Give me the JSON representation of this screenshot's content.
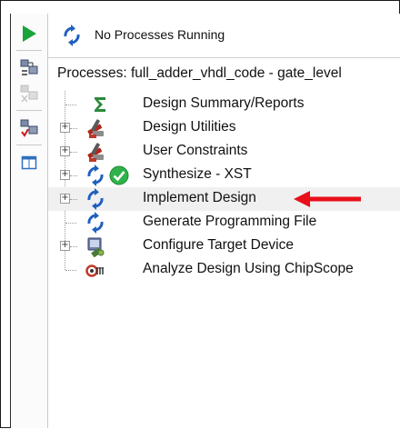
{
  "status": {
    "text": "No Processes Running"
  },
  "processes": {
    "header": "Processes: full_adder_vhdl_code - gate_level",
    "items": [
      {
        "label": "Design Summary/Reports",
        "icon": "sigma-icon",
        "expandable": false
      },
      {
        "label": "Design Utilities",
        "icon": "tools-icon",
        "expandable": true
      },
      {
        "label": "User Constraints",
        "icon": "tools-icon",
        "expandable": true
      },
      {
        "label": "Synthesize - XST",
        "icon": "refresh-icon",
        "status_icon": "check-circle-icon",
        "expandable": true
      },
      {
        "label": "Implement Design",
        "icon": "refresh-icon",
        "expandable": true,
        "highlighted": true
      },
      {
        "label": "Generate Programming File",
        "icon": "refresh-icon",
        "expandable": false
      },
      {
        "label": "Configure Target Device",
        "icon": "device-config-icon",
        "expandable": true
      },
      {
        "label": "Analyze Design Using ChipScope",
        "icon": "chipscope-icon",
        "expandable": false
      }
    ]
  },
  "colors": {
    "run_green": "#1aa33a",
    "refresh_blue": "#1f5fbf",
    "check_green": "#2fb24a",
    "arrow_red": "#e8101a",
    "highlight": "#f0f0f0"
  }
}
